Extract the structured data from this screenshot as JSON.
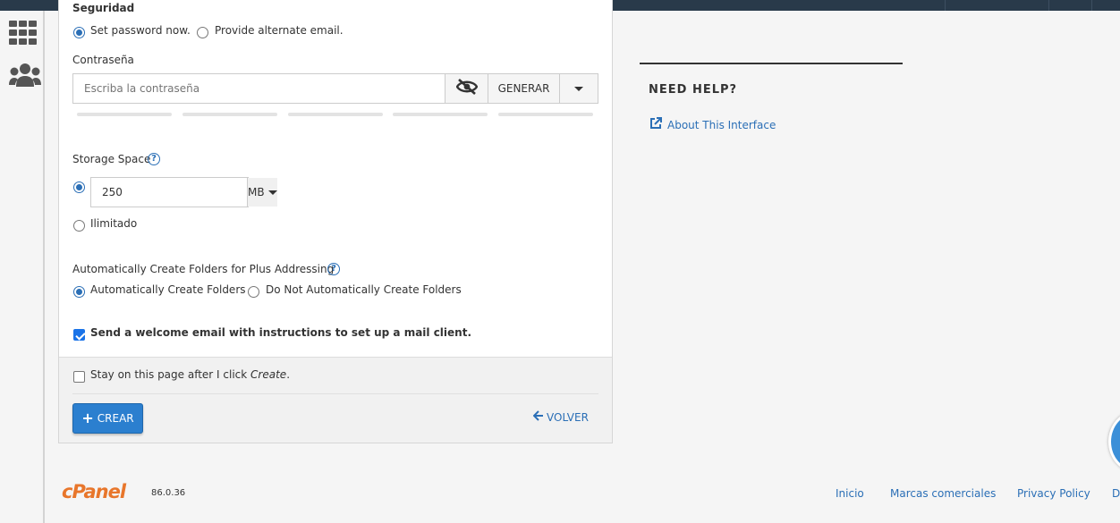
{
  "sidebar": {
    "icons": [
      {
        "name": "apps-grid-icon"
      },
      {
        "name": "users-group-icon"
      }
    ]
  },
  "security": {
    "heading": "Seguridad",
    "option_set": "Set password now.",
    "option_alternate": "Provide alternate email."
  },
  "password": {
    "label": "Contraseña",
    "placeholder": "Escriba la contraseña",
    "generate_label": "GENERAR"
  },
  "storage": {
    "label": "Storage Space",
    "value": "250",
    "unit": "MB",
    "unlimited_label": "Ilimitado"
  },
  "plus_addressing": {
    "label": "Automatically Create Folders for Plus Addressing",
    "option_create": "Automatically Create Folders",
    "option_no_create": "Do Not Automatically Create Folders"
  },
  "welcome_email": {
    "label": "Send a welcome email with instructions to set up a mail client."
  },
  "form_footer": {
    "stay_prefix": "Stay on this page after I click ",
    "stay_emphasis": "Create",
    "stay_suffix": ".",
    "create_label": "CREAR",
    "back_label": "VOLVER"
  },
  "help": {
    "heading": "NEED HELP?",
    "about_link": "About This Interface"
  },
  "footer": {
    "logo_text": "cPanel",
    "version": "86.0.36",
    "links": [
      "Inicio",
      "Marcas comerciales",
      "Privacy Policy",
      "D"
    ]
  },
  "colors": {
    "accent": "#2b6fb6",
    "button": "#2b7fcf",
    "brand": "#e8762b",
    "topbar": "#293a4a"
  }
}
